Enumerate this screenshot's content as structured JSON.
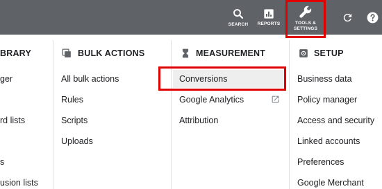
{
  "topbar": {
    "search_label": "SEARCH",
    "reports_label": "REPORTS",
    "tools_label_line1": "TOOLS &",
    "tools_label_line2": "SETTINGS",
    "bg_color": "#5f6368"
  },
  "columns": {
    "library": {
      "title": "BRARY",
      "items": [
        "ger",
        "rd lists",
        "s",
        "usion lists"
      ]
    },
    "bulk_actions": {
      "title": "BULK ACTIONS",
      "icon": "bulk-actions-icon",
      "items": [
        "All bulk actions",
        "Rules",
        "Scripts",
        "Uploads"
      ]
    },
    "measurement": {
      "title": "MEASUREMENT",
      "icon": "hourglass-icon",
      "items": [
        "Conversions",
        "Google Analytics",
        "Attribution"
      ],
      "external_icon": "open-external-icon"
    },
    "setup": {
      "title": "SETUP",
      "icon": "setup-gear-icon",
      "items": [
        "Business data",
        "Policy manager",
        "Access and security",
        "Linked accounts",
        "Preferences",
        "Google Merchant"
      ]
    }
  },
  "highlight_color": "#e00000"
}
